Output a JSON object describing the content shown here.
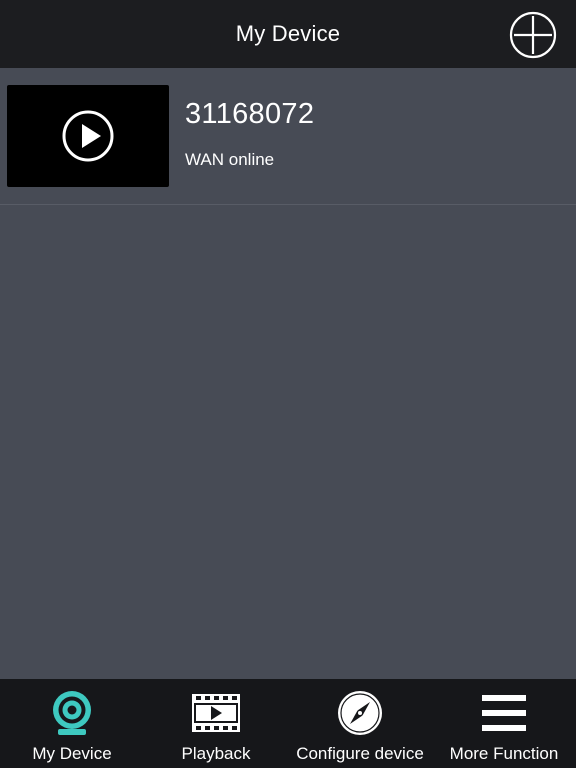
{
  "header": {
    "title": "My Device",
    "add_icon": "plus-circle-icon"
  },
  "devices": [
    {
      "name": "31168072",
      "status": "WAN online",
      "thumb_icon": "play-circle-icon"
    }
  ],
  "tabbar": {
    "tabs": [
      {
        "label": "My Device",
        "icon": "webcam-icon",
        "active": true
      },
      {
        "label": "Playback",
        "icon": "film-play-icon",
        "active": false
      },
      {
        "label": "Configure device",
        "icon": "compass-icon",
        "active": false
      },
      {
        "label": "More Function",
        "icon": "menu-icon",
        "active": false
      }
    ]
  },
  "colors": {
    "header_bg": "#1c1d20",
    "content_bg": "#474b55",
    "tabbar_bg": "#16171a",
    "accent": "#3ec9c0",
    "text": "#ffffff"
  }
}
